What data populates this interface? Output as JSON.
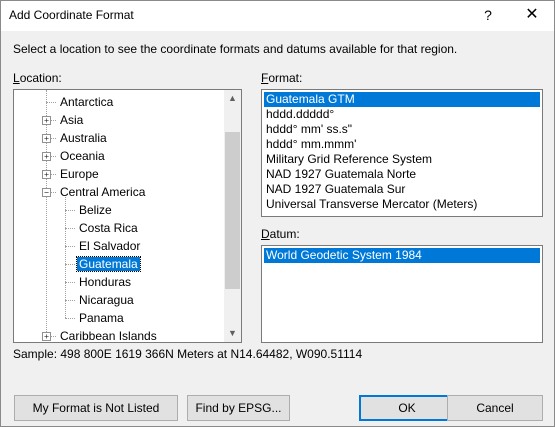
{
  "window": {
    "title": "Add Coordinate Format",
    "help_glyph": "?",
    "close_glyph": "✕"
  },
  "instructions": "Select a location to see the coordinate formats and datums available for that region.",
  "location": {
    "label_accel": "L",
    "label_rest": "ocation:",
    "tree": [
      {
        "label": "Antarctica",
        "level": 0,
        "expander": "none"
      },
      {
        "label": "Asia",
        "level": 0,
        "expander": "+"
      },
      {
        "label": "Australia",
        "level": 0,
        "expander": "+"
      },
      {
        "label": "Oceania",
        "level": 0,
        "expander": "+"
      },
      {
        "label": "Europe",
        "level": 0,
        "expander": "+"
      },
      {
        "label": "Central America",
        "level": 0,
        "expander": "-"
      },
      {
        "label": "Belize",
        "level": 1,
        "expander": "none"
      },
      {
        "label": "Costa Rica",
        "level": 1,
        "expander": "none"
      },
      {
        "label": "El Salvador",
        "level": 1,
        "expander": "none"
      },
      {
        "label": "Guatemala",
        "level": 1,
        "expander": "none",
        "selected": true
      },
      {
        "label": "Honduras",
        "level": 1,
        "expander": "none"
      },
      {
        "label": "Nicaragua",
        "level": 1,
        "expander": "none"
      },
      {
        "label": "Panama",
        "level": 1,
        "expander": "none"
      },
      {
        "label": "Caribbean Islands",
        "level": 0,
        "expander": "+"
      }
    ],
    "scroll_up_glyph": "▲",
    "scroll_down_glyph": "▼"
  },
  "format": {
    "label_accel": "F",
    "label_rest": "ormat:",
    "items": [
      {
        "label": "Guatemala GTM",
        "selected": true
      },
      {
        "label": "hddd.ddddd°"
      },
      {
        "label": "hddd° mm' ss.s\""
      },
      {
        "label": "hddd° mm.mmm'"
      },
      {
        "label": "Military Grid Reference System"
      },
      {
        "label": "NAD 1927 Guatemala Norte"
      },
      {
        "label": "NAD 1927 Guatemala Sur"
      },
      {
        "label": "Universal Transverse Mercator (Meters)"
      }
    ]
  },
  "datum": {
    "label_accel": "D",
    "label_rest": "atum:",
    "items": [
      {
        "label": "World Geodetic System 1984",
        "selected": true
      }
    ]
  },
  "sample": "Sample: 498 800E  1619 366N Meters at N14.64482, W090.51114",
  "buttons": {
    "not_listed": "My Format is Not Listed",
    "find_epsg": "Find by EPSG...",
    "ok": "OK",
    "cancel": "Cancel"
  },
  "colors": {
    "selection": "#0078d7",
    "dialog_bg": "#f0f0f0"
  }
}
